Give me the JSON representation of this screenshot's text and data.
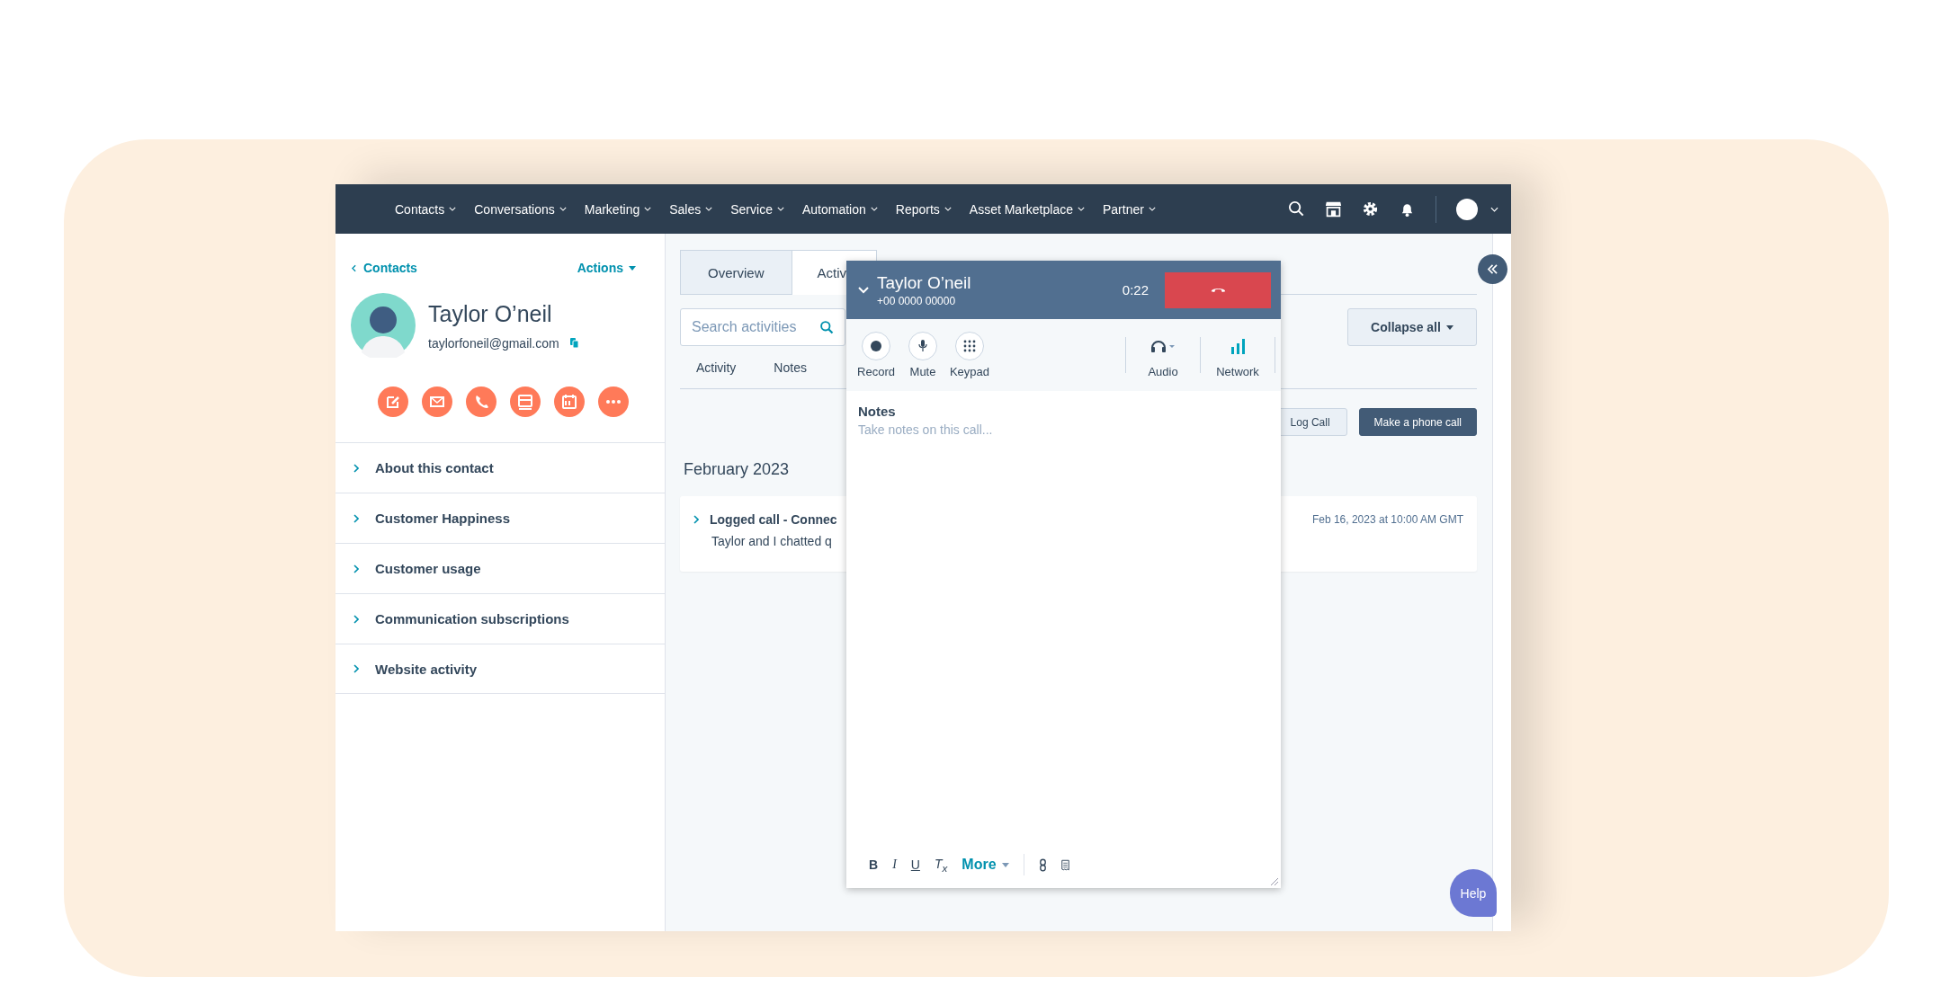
{
  "nav": {
    "items": [
      {
        "label": "Contacts"
      },
      {
        "label": "Conversations"
      },
      {
        "label": "Marketing"
      },
      {
        "label": "Sales"
      },
      {
        "label": "Service"
      },
      {
        "label": "Automation"
      },
      {
        "label": "Reports"
      },
      {
        "label": "Asset Marketplace"
      },
      {
        "label": "Partner"
      }
    ]
  },
  "sidebar": {
    "back_link": "Contacts",
    "actions": "Actions",
    "contact": {
      "name": "Taylor O’neil",
      "email": "taylorfoneil@gmail.com"
    },
    "sections": [
      {
        "label": "About this contact",
        "expanded": false
      },
      {
        "label": "Customer Happiness",
        "expanded": false
      },
      {
        "label": "Customer usage",
        "expanded": false
      },
      {
        "label": "Communication subscriptions",
        "expanded": false
      },
      {
        "label": "Website activity",
        "expanded": false
      }
    ]
  },
  "tabs": [
    {
      "label": "Overview",
      "selected": false
    },
    {
      "label": "Activi",
      "selected": true
    }
  ],
  "search": {
    "placeholder": "Search activities"
  },
  "collapse_button": "Collapse all",
  "activity_tabs": [
    {
      "label": "Activity"
    },
    {
      "label": "Notes"
    }
  ],
  "buttons": [
    "Log Call",
    "Make a phone call"
  ],
  "timeline": {
    "month": "February 2023",
    "entries": [
      {
        "title": "Logged call - Connec",
        "body": "Taylor and I chatted q",
        "timestamp": "Feb 16, 2023 at 10:00 AM GMT",
        "expanded": false
      }
    ]
  },
  "call": {
    "name": "Taylor O’neil",
    "phone": "+00 0000 00000",
    "timer": "0:22",
    "controls": [
      {
        "kind": "record",
        "label": "Record"
      },
      {
        "kind": "mute",
        "label": "Mute"
      },
      {
        "kind": "keypad",
        "label": "Keypad"
      },
      {
        "kind": "audio",
        "label": "Audio"
      },
      {
        "kind": "network",
        "label": "Network"
      }
    ],
    "notes_label": "Notes",
    "notes_placeholder": "Take notes on this call...",
    "format_buttons": [
      {
        "kind": "bold",
        "label": "B"
      },
      {
        "kind": "italic",
        "label": "I"
      },
      {
        "kind": "underline",
        "label": "U"
      },
      {
        "kind": "clear",
        "label": "T$_{x}$"
      }
    ],
    "more": "More"
  },
  "help": "Help"
}
